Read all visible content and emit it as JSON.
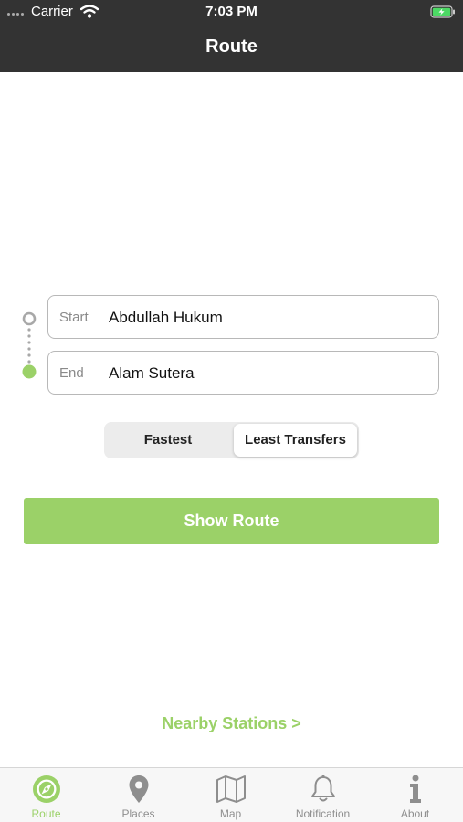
{
  "status_bar": {
    "carrier": "Carrier",
    "time": "7:03 PM",
    "icons": [
      "signal-dots-icon",
      "wifi-icon",
      "battery-charging-icon"
    ]
  },
  "nav": {
    "title": "Route"
  },
  "form": {
    "start_label": "Start",
    "start_value": "Abdullah Hukum",
    "end_label": "End",
    "end_value": "Alam Sutera"
  },
  "segment": {
    "options": [
      "Fastest",
      "Least Transfers"
    ],
    "selected": "Least Transfers"
  },
  "show_route_label": "Show Route",
  "nearby_label": "Nearby Stations >",
  "tabs": [
    {
      "label": "Route",
      "icon": "compass-icon",
      "active": true
    },
    {
      "label": "Places",
      "icon": "map-pin-icon",
      "active": false
    },
    {
      "label": "Map",
      "icon": "folded-map-icon",
      "active": false
    },
    {
      "label": "Notification",
      "icon": "bell-icon",
      "active": false
    },
    {
      "label": "About",
      "icon": "info-icon",
      "active": false
    }
  ],
  "colors": {
    "accent": "#9bd168",
    "nav_background": "#333333",
    "inactive_tab": "#8e8e8e",
    "battery": "#4cd964"
  }
}
